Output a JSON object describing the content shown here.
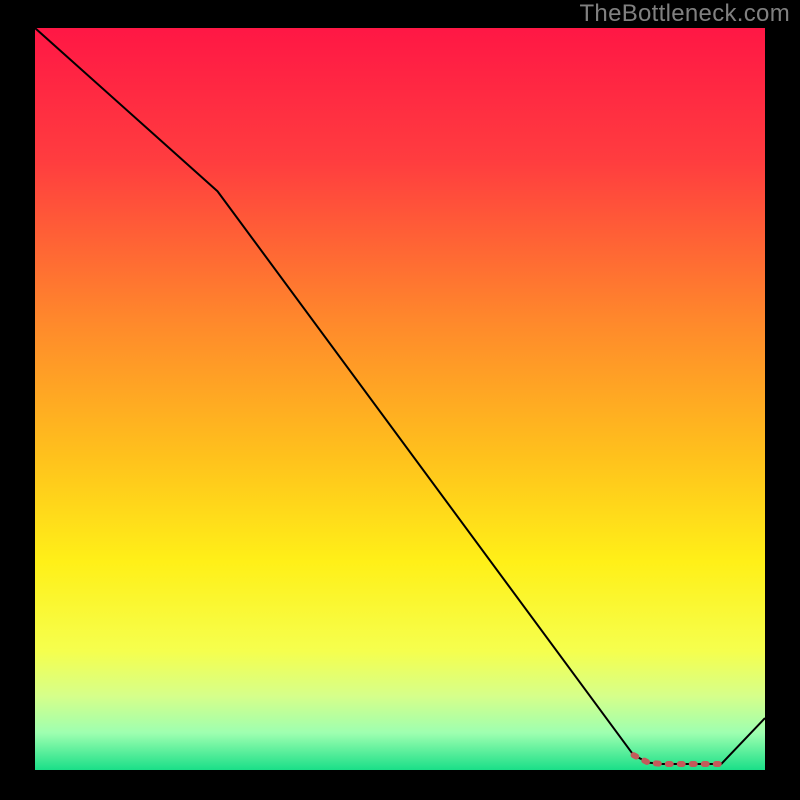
{
  "attribution": "TheBottleneck.com",
  "chart_data": {
    "type": "line",
    "title": "",
    "xlabel": "",
    "ylabel": "",
    "xlim": [
      0,
      100
    ],
    "ylim": [
      0,
      100
    ],
    "background_gradient": {
      "stops": [
        {
          "offset": 0.0,
          "color": "#ff1745"
        },
        {
          "offset": 0.18,
          "color": "#ff3d3f"
        },
        {
          "offset": 0.4,
          "color": "#ff8a2b"
        },
        {
          "offset": 0.58,
          "color": "#ffc21c"
        },
        {
          "offset": 0.72,
          "color": "#fff018"
        },
        {
          "offset": 0.84,
          "color": "#f5ff4e"
        },
        {
          "offset": 0.9,
          "color": "#d6ff8a"
        },
        {
          "offset": 0.95,
          "color": "#9effb0"
        },
        {
          "offset": 1.0,
          "color": "#1adf88"
        }
      ]
    },
    "series": [
      {
        "name": "bottleneck-curve",
        "color": "#000000",
        "stroke_width": 2,
        "x": [
          0,
          25,
          82,
          84,
          86,
          88,
          90,
          92,
          94,
          100
        ],
        "y": [
          100,
          78,
          2,
          1,
          0.8,
          0.8,
          0.8,
          0.8,
          0.8,
          7
        ]
      },
      {
        "name": "optimal-marker",
        "color": "#c45a5a",
        "stroke_width": 6,
        "linecap": "round",
        "x": [
          82,
          84,
          86,
          88,
          90,
          92,
          94
        ],
        "y": [
          2,
          1,
          0.8,
          0.8,
          0.8,
          0.8,
          0.8
        ],
        "dashed": true
      }
    ]
  }
}
